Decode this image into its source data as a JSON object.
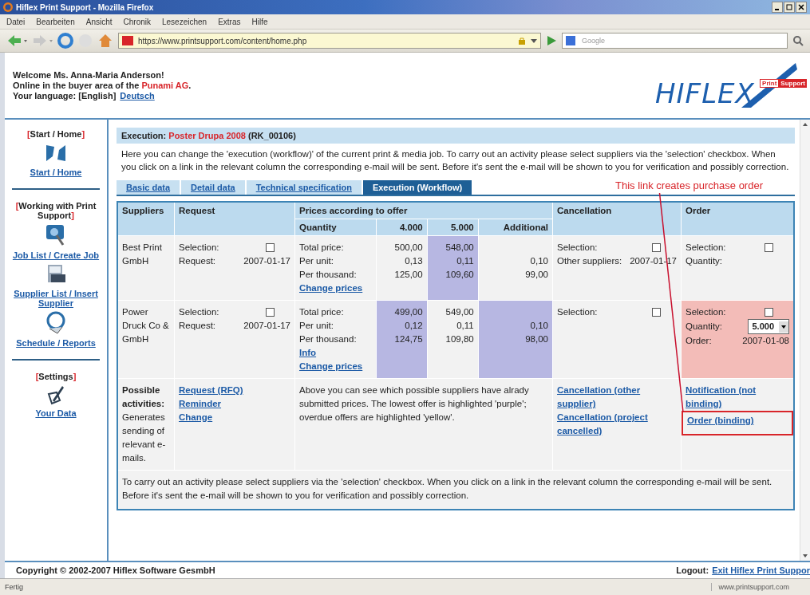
{
  "browser": {
    "title": "Hiflex Print Support - Mozilla Firefox",
    "menu": [
      {
        "label": "Datei"
      },
      {
        "label": "Bearbeiten"
      },
      {
        "label": "Ansicht"
      },
      {
        "label": "Chronik"
      },
      {
        "label": "Lesezeichen"
      },
      {
        "label": "Extras"
      },
      {
        "label": "Hilfe"
      }
    ],
    "url": "https://www.printsupport.com/content/home.php",
    "search_placeholder": "Google",
    "status": "Fertig",
    "status_url": "www.printsupport.com"
  },
  "header": {
    "lines": [
      [
        {
          "text": "Welcome Ms. Anna-Maria Anderson!",
          "accent": false
        }
      ],
      [
        {
          "text": "Online in the buyer area of the ",
          "accent": false
        },
        {
          "text": "Punami AG",
          "accent": true
        },
        {
          "text": ".",
          "accent": false
        }
      ],
      [
        {
          "text": "Your language: [English]",
          "accent": false
        }
      ]
    ],
    "language_link": "Deutsch",
    "logo": {
      "word": "HIFLEX",
      "tag_left": "Print",
      "tag_right": "Support"
    }
  },
  "sidebar": [
    {
      "title": {
        "open": "[",
        "text": "Start / Home",
        "close": "]"
      },
      "items": [
        {
          "kind": "home",
          "label": "Start / Home"
        }
      ]
    },
    {
      "title": {
        "open": "[",
        "text": "Working with Print Support",
        "close": "]"
      },
      "items": [
        {
          "kind": "jobs",
          "label": "Job List / Create Job"
        },
        {
          "kind": "suppliers",
          "label": "Supplier List / Insert Supplier"
        },
        {
          "kind": "schedule",
          "label": "Schedule / Reports"
        }
      ]
    },
    {
      "title": {
        "open": "[",
        "text": "Settings",
        "close": "]"
      },
      "items": [
        {
          "kind": "settings",
          "label": "Your Data"
        }
      ]
    }
  ],
  "content": {
    "heading": {
      "label": "Execution:",
      "project": "Poster Drupa 2008",
      "code": "(RK_00106)"
    },
    "intro": "Here you can change the 'execution (workflow)' of the current print & media job. To carry out an activity please select suppliers via the 'selection' checkbox. When you click on a link in the relevant column the corresponding e-mail will be sent. Before it's sent the e-mail will be shown to you for verification and possibly correction.",
    "tabs": [
      {
        "label": "Basic data",
        "selected": false
      },
      {
        "label": "Detail data",
        "selected": false
      },
      {
        "label": "Technical specification",
        "selected": false
      },
      {
        "label": "Execution (Workflow)",
        "selected": true
      }
    ],
    "annotation": "This link creates purchase order",
    "table": {
      "columns": {
        "suppliers": "Suppliers",
        "request": "Request",
        "prices": "Prices according to offer",
        "cancellation": "Cancellation",
        "order": "Order"
      },
      "price_columns": [
        "Quantity",
        "4.000",
        "5.000",
        "Additional"
      ],
      "rows": [
        {
          "supplier": "Best Print GmbH",
          "request": [
            {
              "kind": "checkbox",
              "label": "Selection:",
              "checked": false
            },
            {
              "kind": "text",
              "label": "Request:",
              "value": "2007-01-17"
            }
          ],
          "price_labels": [
            "Total price:",
            "Per unit:",
            "Per thousand:"
          ],
          "price_links": [
            "Change prices"
          ],
          "prices": [
            {
              "total": "500,00",
              "unit": "0,13",
              "thousand": "125,00",
              "lowest": false
            },
            {
              "total": "548,00",
              "unit": "0,11",
              "thousand": "109,60",
              "lowest": true
            },
            {
              "unit": "0,10",
              "thousand": "99,00",
              "lowest": false
            }
          ],
          "cancellation": [
            {
              "kind": "checkbox",
              "label": "Selection:",
              "checked": false
            },
            {
              "kind": "text",
              "label": "Other suppliers:",
              "value": "2007-01-17"
            }
          ],
          "order_highlighted": false,
          "order": [
            {
              "kind": "checkbox",
              "label": "Selection:",
              "checked": false
            },
            {
              "kind": "label",
              "label": "Quantity:"
            }
          ]
        },
        {
          "supplier": "Power Druck Co & GmbH",
          "request": [
            {
              "kind": "checkbox",
              "label": "Selection:",
              "checked": false
            },
            {
              "kind": "text",
              "label": "Request:",
              "value": "2007-01-17"
            }
          ],
          "price_labels": [
            "Total price:",
            "Per unit:",
            "Per thousand:"
          ],
          "price_links": [
            "Info",
            "Change prices"
          ],
          "prices": [
            {
              "total": "499,00",
              "unit": "0,12",
              "thousand": "124,75",
              "lowest": true
            },
            {
              "total": "549,00",
              "unit": "0,11",
              "thousand": "109,80",
              "lowest": false
            },
            {
              "unit": "0,10",
              "thousand": "98,00",
              "lowest": true
            }
          ],
          "cancellation": [
            {
              "kind": "checkbox",
              "label": "Selection:",
              "checked": false
            }
          ],
          "order_highlighted": true,
          "order": [
            {
              "kind": "checkbox",
              "label": "Selection:",
              "checked": false
            },
            {
              "kind": "select",
              "label": "Quantity:",
              "value": "5.000"
            },
            {
              "kind": "text",
              "label": "Order:",
              "value": "2007-01-08"
            }
          ]
        }
      ],
      "activities": {
        "label": "Possible activities:",
        "description": "Generates sending of relevant e-mails.",
        "request_links": [
          {
            "label": "Request (RFQ)",
            "framed": false
          },
          {
            "label": "Reminder",
            "framed": false
          },
          {
            "label": "Change",
            "framed": false
          }
        ],
        "note": "Above you can see which possible suppliers have alrady submitted prices. The lowest offer is highlighted 'purple'; overdue offers are highlighted 'yellow'.",
        "cancellation_links": [
          {
            "label": "Cancellation (other supplier)",
            "framed": false
          },
          {
            "label": "Cancellation (project cancelled)",
            "framed": false
          }
        ],
        "order_links": [
          {
            "label": "Notification (not binding)",
            "framed": false
          },
          {
            "label": "Order (binding)",
            "framed": true
          }
        ]
      },
      "footnote": "To carry out an activity please select suppliers via the 'selection' checkbox. When you click on a link in the relevant column the corresponding e-mail will be sent. Before it's sent the e-mail will be shown to you for verification and possibly correction."
    }
  },
  "footer": {
    "copyright": "Copyright © 2002-2007 Hiflex Software GesmbH",
    "logout_label": "Logout:",
    "logout_link": "Exit Hiflex Print Suppor"
  }
}
